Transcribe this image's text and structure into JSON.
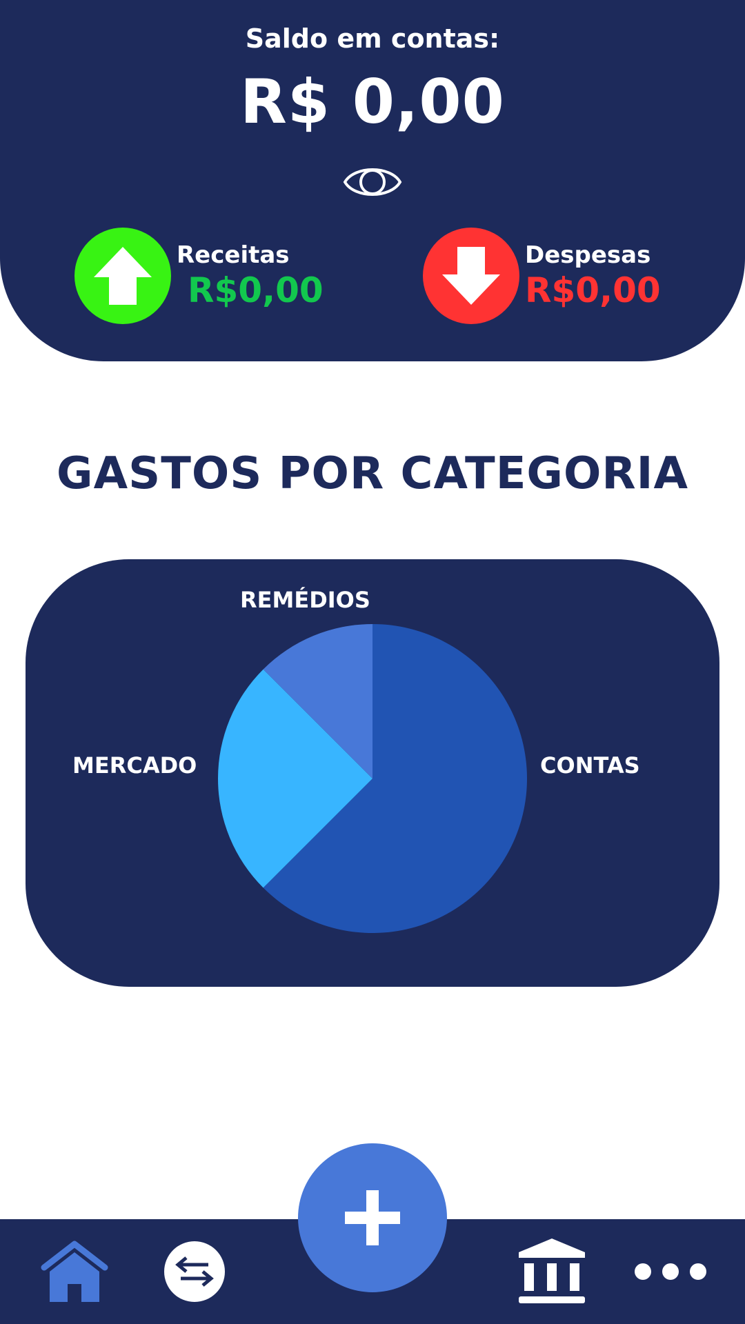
{
  "header": {
    "balance_label": "Saldo em contas:",
    "balance_value": "R$ 0,00",
    "visibility_icon": "eye-icon",
    "income": {
      "label": "Receitas",
      "value": "R$0,00",
      "icon": "arrow-up-icon",
      "color": "#12c84e"
    },
    "expenses": {
      "label": "Despesas",
      "value": "R$0,00",
      "icon": "arrow-down-icon",
      "color": "#ff3333"
    }
  },
  "section": {
    "title": "GASTOS POR CATEGORIA"
  },
  "chart_data": {
    "type": "pie",
    "title": "",
    "slices": [
      {
        "name": "CONTAS",
        "value": 62.5,
        "color": "#2154b3"
      },
      {
        "name": "MERCADO",
        "value": 25,
        "color": "#38b5ff"
      },
      {
        "name": "REMÉDIOS",
        "value": 12.5,
        "color": "#4878d8"
      }
    ]
  },
  "bottom_nav": {
    "items": [
      {
        "icon": "home-icon"
      },
      {
        "icon": "transfer-icon"
      },
      {
        "icon": "plus-icon"
      },
      {
        "icon": "bank-icon"
      },
      {
        "icon": "more-icon"
      }
    ]
  },
  "colors": {
    "navy": "#1d2a5b",
    "accent_blue": "#4878d8",
    "income_circle": "#38f313",
    "expense_circle": "#ff3333"
  }
}
